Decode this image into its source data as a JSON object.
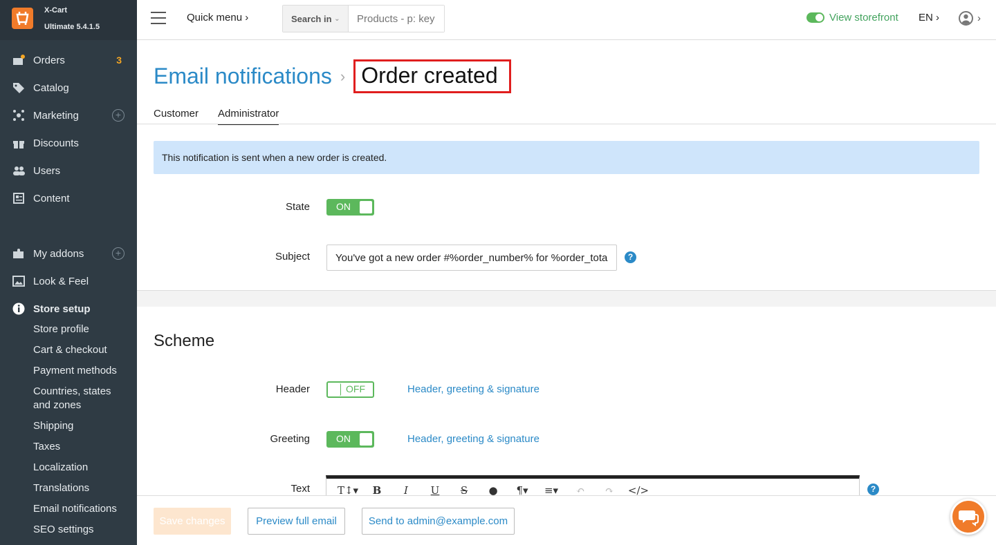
{
  "brand": {
    "name": "X-Cart",
    "version": "Ultimate 5.4.1.5"
  },
  "sidebar": {
    "items": [
      {
        "label": "Orders",
        "icon": "orders-icon",
        "badge": "3"
      },
      {
        "label": "Catalog",
        "icon": "tag-icon"
      },
      {
        "label": "Marketing",
        "icon": "marketing-icon"
      },
      {
        "label": "Discounts",
        "icon": "gift-icon"
      },
      {
        "label": "Users",
        "icon": "users-icon"
      },
      {
        "label": "Content",
        "icon": "content-icon"
      },
      {
        "label": "My addons",
        "icon": "puzzle-icon"
      },
      {
        "label": "Look & Feel",
        "icon": "image-icon"
      },
      {
        "label": "Store setup",
        "icon": "info-icon"
      }
    ],
    "store_setup_sub": [
      "Store profile",
      "Cart & checkout",
      "Payment methods",
      "Countries, states",
      "and zones",
      "Shipping",
      "Taxes",
      "Localization",
      "Translations",
      "Email notifications",
      "SEO settings"
    ]
  },
  "topbar": {
    "quick_menu": "Quick menu",
    "search_in": "Search in",
    "search_placeholder": "Products - p: key",
    "view_storefront": "View storefront",
    "lang": "EN"
  },
  "page": {
    "breadcrumb_link": "Email notifications",
    "title": "Order created",
    "tabs": [
      "Customer",
      "Administrator"
    ],
    "active_tab": "Administrator",
    "info": "This notification is sent when a new order is created.",
    "state_label": "State",
    "state_value": "ON",
    "subject_label": "Subject",
    "subject_value": "You've got a new order #%order_number% for %order_total%",
    "scheme_title": "Scheme",
    "header_label": "Header",
    "header_value": "OFF",
    "header_link": "Header, greeting & signature",
    "greeting_label": "Greeting",
    "greeting_value": "ON",
    "greeting_link": "Header, greeting & signature",
    "text_label": "Text"
  },
  "footer": {
    "save": "Save changes",
    "preview": "Preview full email",
    "send": "Send to admin@example.com"
  },
  "colors": {
    "accent": "#2b8ac7",
    "sidebar": "#2f3b44",
    "brand": "#f07b2a",
    "success": "#5cb85c",
    "highlight": "#e01e1e"
  }
}
